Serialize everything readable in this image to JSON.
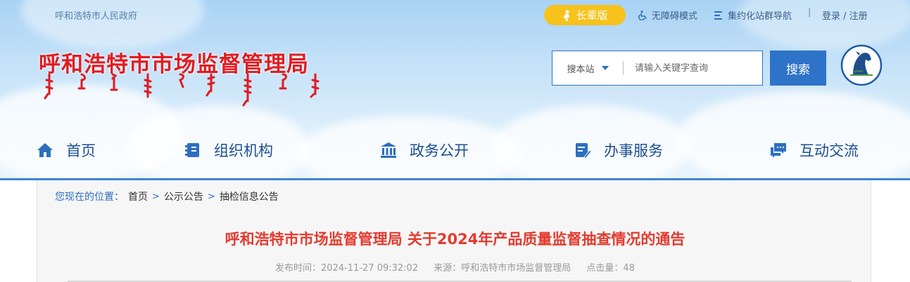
{
  "header": {
    "gov_link": "呼和浩特市人民政府",
    "elder_button": "长辈版",
    "accessibility": "无障碍模式",
    "site_nav": "集约化站群导航",
    "separator": "|",
    "login": "登录 / 注册",
    "site_title": "呼和浩特市市场监督管理局",
    "search": {
      "scope": "搜本站",
      "placeholder": "请输入关键字查询",
      "button": "搜索"
    },
    "colors": {
      "title_red": "#e11b22",
      "accent_blue": "#2f73c9",
      "elder_yellow": "#f7c21b"
    }
  },
  "nav": {
    "items": [
      {
        "label": "首页",
        "icon": "home-icon"
      },
      {
        "label": "组织机构",
        "icon": "org-book-icon"
      },
      {
        "label": "政务公开",
        "icon": "bank-icon"
      },
      {
        "label": "办事服务",
        "icon": "service-doc-icon"
      },
      {
        "label": "互动交流",
        "icon": "chat-icon"
      }
    ]
  },
  "breadcrumb": {
    "prefix": "您现在的位置：",
    "items": [
      "首页",
      "公示公告",
      "抽检信息公告"
    ],
    "separator": ">"
  },
  "article": {
    "title": "呼和浩特市市场监督管理局 关于2024年产品质量监督抽查情况的通告",
    "published": "发布时间：2024-11-27 09:32:02",
    "source": "来源：呼和浩特市市场监督管理局",
    "hits": "点击量：48",
    "title_color": "#e43a2f"
  }
}
